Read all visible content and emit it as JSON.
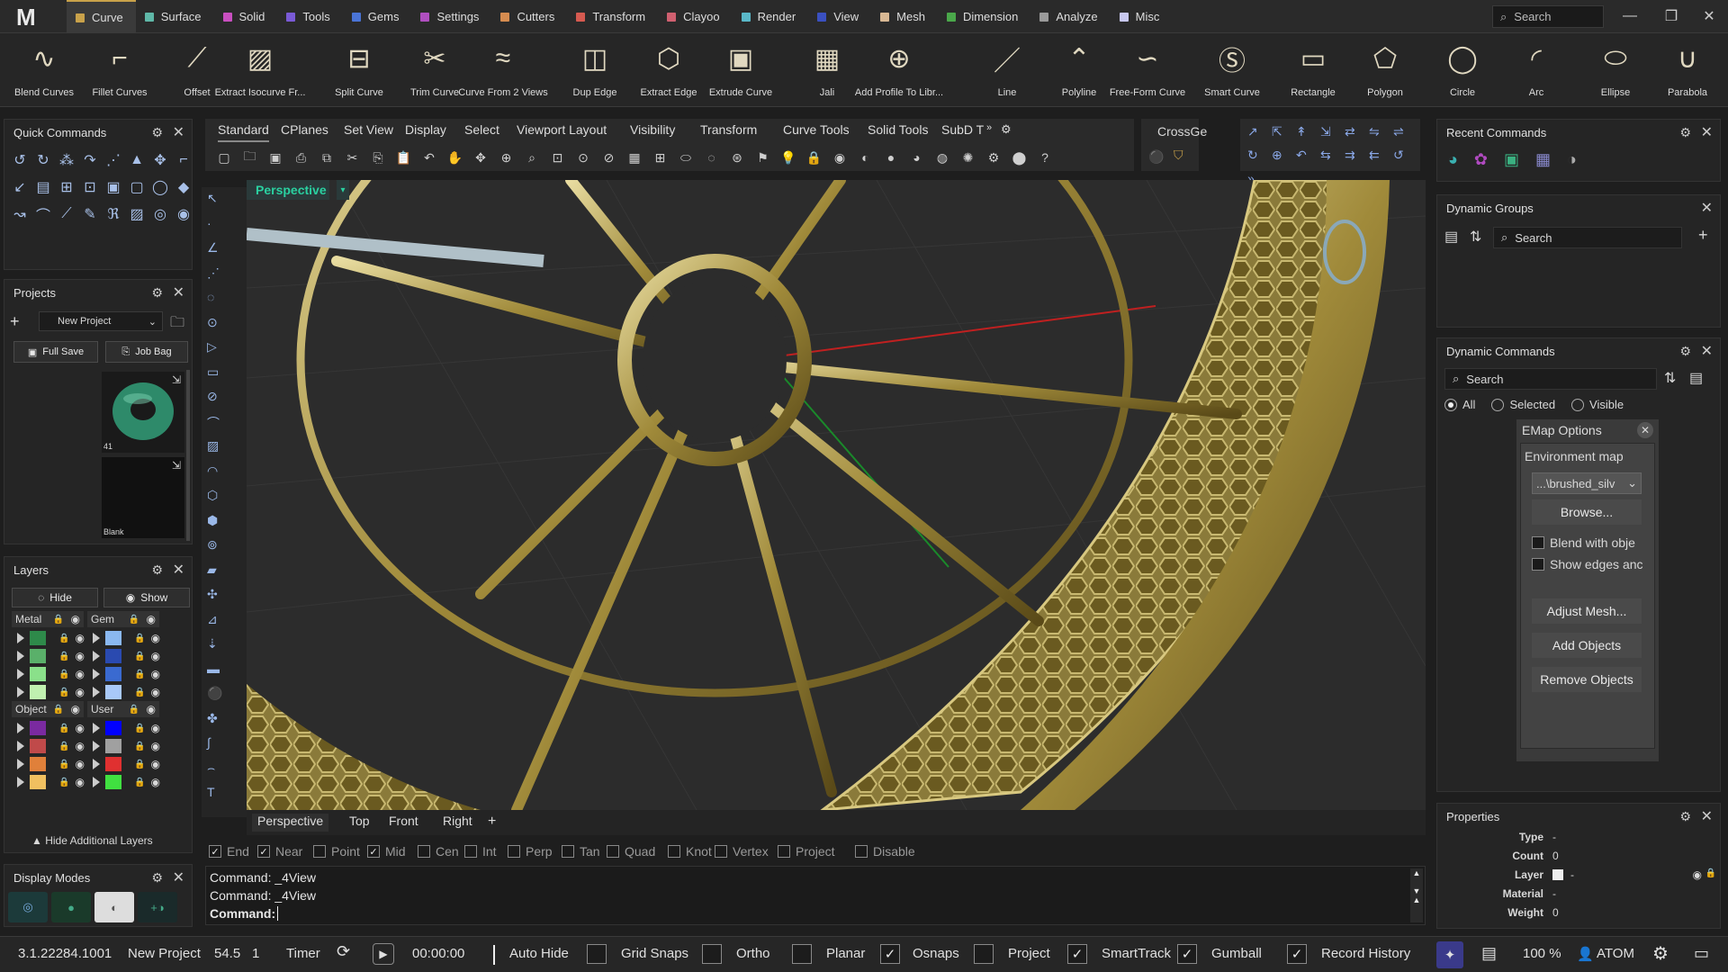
{
  "app": {
    "logo": "M"
  },
  "menu": [
    {
      "label": "Curve",
      "color": "#c9a24a",
      "active": true
    },
    {
      "label": "Surface",
      "color": "#5fb8a8"
    },
    {
      "label": "Solid",
      "color": "#c84fc0"
    },
    {
      "label": "Tools",
      "color": "#7a5ad6"
    },
    {
      "label": "Gems",
      "color": "#4a74d6"
    },
    {
      "label": "Settings",
      "color": "#b04fc0"
    },
    {
      "label": "Cutters",
      "color": "#d68c50"
    },
    {
      "label": "Transform",
      "color": "#d65a50"
    },
    {
      "label": "Clayoo",
      "color": "#d06070"
    },
    {
      "label": "Render",
      "color": "#5ab8c8"
    },
    {
      "label": "View",
      "color": "#3a50c0"
    },
    {
      "label": "Mesh",
      "color": "#d8b894"
    },
    {
      "label": "Dimension",
      "color": "#4aa84a"
    },
    {
      "label": "Analyze",
      "color": "#9a9a9a"
    },
    {
      "label": "Misc",
      "color": "#c8c8f0"
    }
  ],
  "top_search": "Search",
  "ribbon": [
    "Blend Curves",
    "Fillet Curves",
    "Offset",
    "Extract Isocurve Fr...",
    "Split Curve",
    "Trim Curve",
    "Curve From 2 Views",
    "Dup Edge",
    "Extract Edge",
    "Extrude Curve",
    "Jali",
    "Add Profile To Libr...",
    "Line",
    "Polyline",
    "Free-Form Curve",
    "Smart Curve",
    "Rectangle",
    "Polygon",
    "Circle",
    "Arc",
    "Ellipse",
    "Parabola"
  ],
  "quick_commands": {
    "title": "Quick Commands"
  },
  "projects": {
    "title": "Projects",
    "dropdown": "New Project",
    "full_save": "Full Save",
    "job_bag": "Job Bag",
    "thumb1_label": "41",
    "thumb2_label": "Blank"
  },
  "layers": {
    "title": "Layers",
    "hide": "Hide",
    "show": "Show",
    "groups": [
      {
        "name": "Metal",
        "colors": [
          "#2e8a4a",
          "#5ab06a",
          "#8ae08a",
          "#c0f0b0"
        ]
      },
      {
        "name": "Gem",
        "colors": [
          "#8ab8f0",
          "#2a4ab0",
          "#3a6ad0",
          "#a8c8f8"
        ]
      },
      {
        "name": "Object",
        "colors": [
          "#7a2aa0",
          "#c04a4a",
          "#e0803a",
          "#f0c060"
        ]
      },
      {
        "name": "User",
        "colors": [
          "#0000ff",
          "#a0a0a0",
          "#e03030",
          "#40e040"
        ]
      }
    ],
    "hide_additional": "Hide Additional Layers"
  },
  "display_modes": {
    "title": "Display Modes"
  },
  "toolbar_tabs": [
    "Standard",
    "CPlanes",
    "Set View",
    "Display",
    "Select",
    "Viewport Layout",
    "Visibility",
    "Transform",
    "Curve Tools",
    "Solid Tools",
    "SubD T"
  ],
  "crossgen_tab": "CrossGe",
  "viewport": {
    "title": "Perspective"
  },
  "view_tabs": [
    "Perspective",
    "Top",
    "Front",
    "Right"
  ],
  "osnaps": [
    {
      "label": "End",
      "checked": true
    },
    {
      "label": "Near",
      "checked": true
    },
    {
      "label": "Point",
      "checked": false
    },
    {
      "label": "Mid",
      "checked": true
    },
    {
      "label": "Cen",
      "checked": false
    },
    {
      "label": "Int",
      "checked": false
    },
    {
      "label": "Perp",
      "checked": false
    },
    {
      "label": "Tan",
      "checked": false
    },
    {
      "label": "Quad",
      "checked": false
    },
    {
      "label": "Knot",
      "checked": false
    },
    {
      "label": "Vertex",
      "checked": false
    },
    {
      "label": "Project",
      "checked": false
    },
    {
      "label": "Disable",
      "checked": false
    }
  ],
  "command_history": [
    "Command: _4View",
    "Command: _4View"
  ],
  "command_prompt": "Command:",
  "recent_commands": {
    "title": "Recent Commands"
  },
  "dynamic_groups": {
    "title": "Dynamic Groups",
    "search": "Search"
  },
  "dynamic_commands": {
    "title": "Dynamic Commands",
    "search": "Search",
    "radio": [
      "All",
      "Selected",
      "Visible"
    ],
    "emap": {
      "title": "EMap Options",
      "env_label": "Environment map",
      "env_value": "...\\brushed_silv",
      "browse": "Browse...",
      "blend": "Blend with obje",
      "show_edges": "Show edges anc",
      "adjust": "Adjust Mesh...",
      "add": "Add Objects",
      "remove": "Remove Objects"
    }
  },
  "properties": {
    "title": "Properties",
    "rows": [
      {
        "k": "Type",
        "v": "-"
      },
      {
        "k": "Count",
        "v": "0"
      },
      {
        "k": "Layer",
        "v": "-"
      },
      {
        "k": "Material",
        "v": "-"
      },
      {
        "k": "Weight",
        "v": "0"
      }
    ]
  },
  "status": {
    "version": "3.1.22284.1001",
    "project": "New Project",
    "units": "54.5",
    "num": "1",
    "timer": "Timer",
    "time": "00:00:00",
    "toggles": [
      {
        "label": "Auto Hide",
        "checked": false
      },
      {
        "label": "Grid Snaps",
        "checked": false
      },
      {
        "label": "Ortho",
        "checked": false
      },
      {
        "label": "Planar",
        "checked": true
      },
      {
        "label": "Osnaps",
        "checked": false
      },
      {
        "label": "Project",
        "checked": true
      },
      {
        "label": "SmartTrack",
        "checked": true
      },
      {
        "label": "Gumball",
        "checked": true
      },
      {
        "label": "Record History",
        "checked": false
      }
    ],
    "zoom": "100 %",
    "user": "ATOM"
  }
}
